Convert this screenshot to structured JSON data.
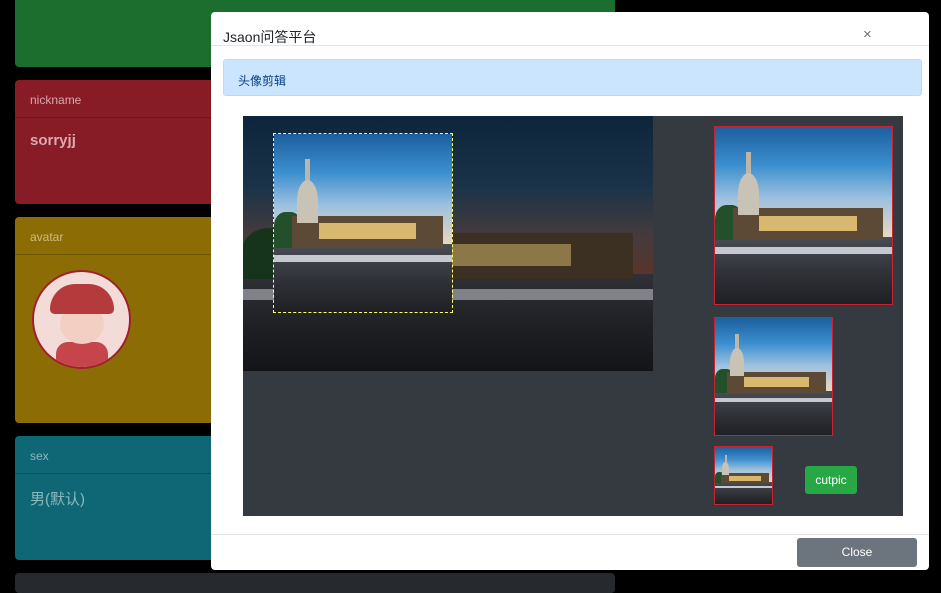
{
  "background": {
    "nickname": {
      "label": "nickname",
      "value": "sorryjj"
    },
    "avatar": {
      "label": "avatar"
    },
    "sex": {
      "label": "sex",
      "value": "男(默认)"
    }
  },
  "modal": {
    "title": "Jsaon问答平台",
    "close_icon": "×",
    "alert_text": "头像剪辑",
    "cut_button": "cutpic",
    "footer_close": "Close"
  },
  "colors": {
    "success": "#28a745",
    "secondary": "#6c757d",
    "alert_bg": "#cce5ff",
    "preview_border": "#c82333"
  }
}
